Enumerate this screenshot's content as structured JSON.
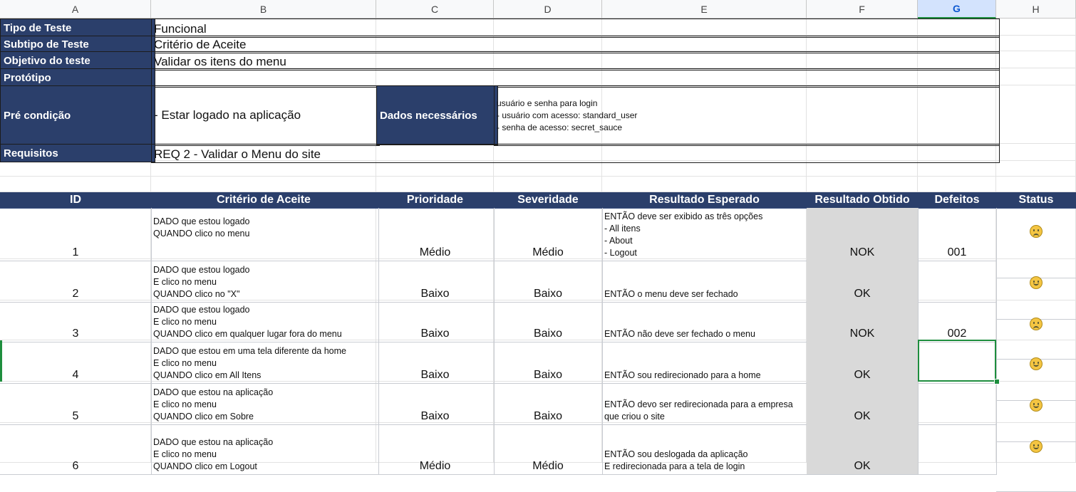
{
  "columns": [
    "A",
    "B",
    "C",
    "D",
    "E",
    "F",
    "G",
    "H"
  ],
  "selected_column": "G",
  "header_info": {
    "tipo_label": "Tipo de Teste",
    "tipo_value": "Funcional",
    "subtipo_label": "Subtipo de Teste",
    "subtipo_value": "Critério de Aceite",
    "objetivo_label": "Objetivo do teste",
    "objetivo_value": "Validar os itens do menu",
    "prototipo_label": "Protótipo",
    "prototipo_value": "",
    "precondicao_label": "Pré condição",
    "precondicao_value": "- Estar logado na aplicação",
    "dados_label": "Dados necessários",
    "dados_value": "usuário e senha para login\n- usuário com acesso: standard_user\n- senha de acesso: secret_sauce",
    "requisitos_label": "Requisitos",
    "requisitos_value": "REQ 2 - Validar o Menu do site"
  },
  "table": {
    "headers": [
      "ID",
      "Critério de Aceite",
      "Prioridade",
      "Severidade",
      "Resultado Esperado",
      "Resultado Obtido",
      "Defeitos",
      "Status"
    ],
    "rows": [
      {
        "id": "1",
        "criterio": "DADO que estou logado\nQUANDO clico no menu\n\n",
        "prioridade": "Médio",
        "severidade": "Médio",
        "esperado": "ENTÃO deve ser exibido as três opções\n- All itens\n- About\n- Logout",
        "obtido": "NOK",
        "defeitos": "001",
        "status": "sad-face"
      },
      {
        "id": "2",
        "criterio": "DADO que estou logado\nE clico no menu\nQUANDO clico no \"X\"",
        "prioridade": "Baixo",
        "severidade": "Baixo",
        "esperado": "ENTÃO o menu deve ser fechado",
        "obtido": "OK",
        "defeitos": "",
        "status": "happy-face"
      },
      {
        "id": "3",
        "criterio": "DADO que estou logado\nE clico no menu\nQUANDO clico em qualquer lugar fora do menu",
        "prioridade": "Baixo",
        "severidade": "Baixo",
        "esperado": "ENTÃO não deve ser fechado o menu",
        "obtido": "NOK",
        "defeitos": "002",
        "status": "sad-face"
      },
      {
        "id": "4",
        "criterio": "DADO que estou em uma tela diferente da home\nE clico no menu\nQUANDO clico em All Itens",
        "prioridade": "Baixo",
        "severidade": "Baixo",
        "esperado": "ENTÃO sou redirecionado para a home",
        "obtido": "OK",
        "defeitos": "",
        "status": "happy-face"
      },
      {
        "id": "5",
        "criterio": "DADO que estou na aplicação\nE clico no menu\nQUANDO clico em Sobre",
        "prioridade": "Baixo",
        "severidade": "Baixo",
        "esperado": "ENTÃO devo ser redirecionada para a empresa\nque criou o site",
        "obtido": "OK",
        "defeitos": "",
        "status": "happy-face"
      },
      {
        "id": "6",
        "criterio": "DADO que estou na aplicação\nE clico no menu\nQUANDO clico em Logout",
        "prioridade": "Médio",
        "severidade": "Médio",
        "esperado": "ENTÃO sou deslogada da aplicação\nE redirecionada para a tela de login",
        "obtido": "OK",
        "defeitos": "",
        "status": "happy-face"
      }
    ]
  }
}
